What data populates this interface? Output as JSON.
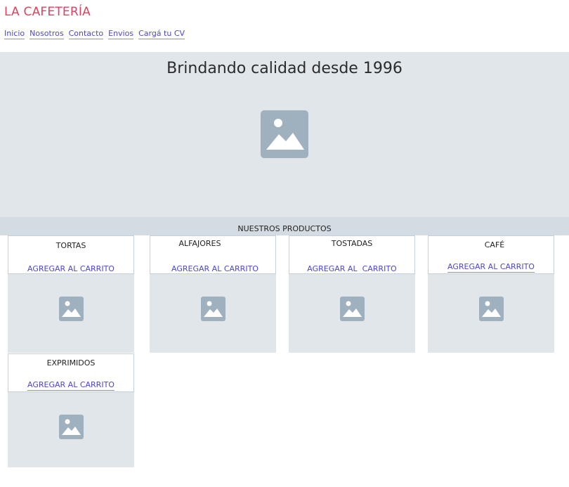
{
  "brand": {
    "name": "LA CAFETERÍA"
  },
  "nav": {
    "items": [
      "Inicio",
      "Nosotros",
      "Contacto",
      "Envios",
      "Cargá tu CV"
    ]
  },
  "hero": {
    "title": "Brindando calidad desde 1996",
    "image_icon": "image-placeholder-icon"
  },
  "products": {
    "heading": "NUESTROS PRODUCTOS",
    "items": [
      {
        "name": "TORTAS",
        "button": "AGREGAR AL CARRITO"
      },
      {
        "name": "ALFAJORES",
        "button": "AGREGAR AL CARRITO"
      },
      {
        "name": "TOSTADAS",
        "button": "AGREGAR AL  CARRITO"
      },
      {
        "name": "CAFÉ",
        "button": "AGREGAR AL CARRITO"
      },
      {
        "name": "EXPRIMIDOS",
        "button": "AGREGAR AL CARRITO"
      }
    ]
  },
  "colors": {
    "brand": "#d9455f",
    "link": "#4b46d6",
    "placeholder_bg": "#e1e6eb",
    "placeholder_icon": "#9fb0bf"
  }
}
